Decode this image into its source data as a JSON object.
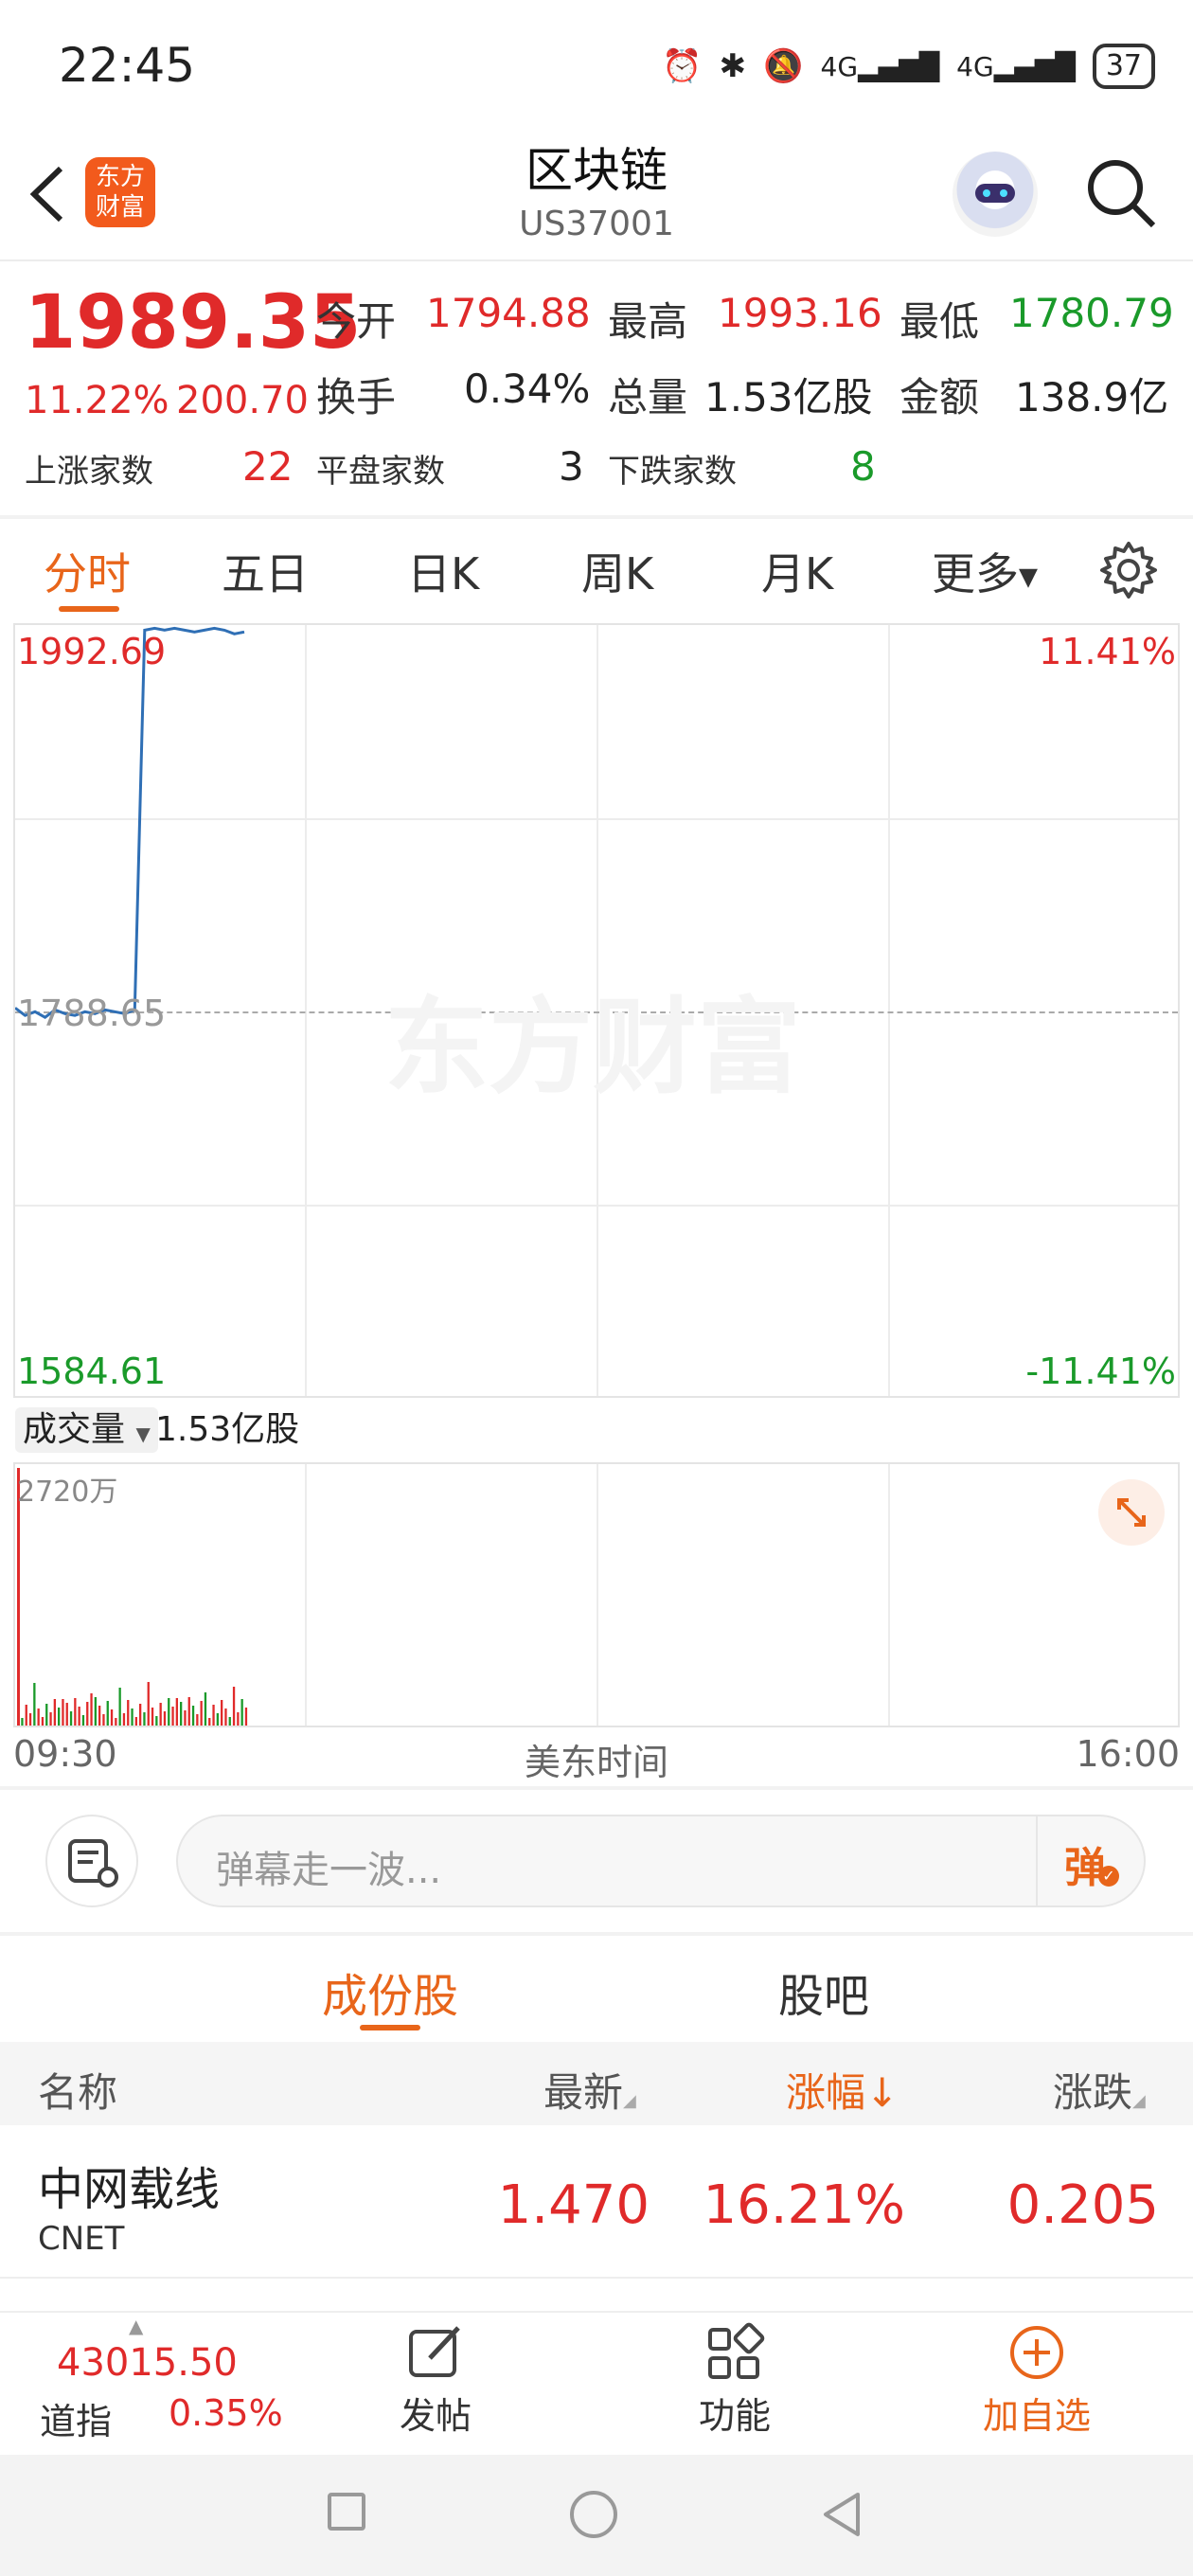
{
  "status_bar": {
    "time": "22:45",
    "battery": "37"
  },
  "header": {
    "title": "区块链",
    "code": "US37001",
    "logo_text": "东方财富"
  },
  "quote": {
    "price": "1989.35",
    "change_pct": "11.22%",
    "change_amt": "200.70",
    "stats": [
      {
        "label": "今开",
        "value": "1794.88",
        "color": "red"
      },
      {
        "label": "最高",
        "value": "1993.16",
        "color": "red"
      },
      {
        "label": "最低",
        "value": "1780.79",
        "color": "green"
      },
      {
        "label": "换手",
        "value": "0.34%",
        "color": "dark"
      },
      {
        "label": "总量",
        "value": "1.53亿股",
        "color": "dark"
      },
      {
        "label": "金额",
        "value": "138.9亿",
        "color": "dark"
      }
    ],
    "counts": [
      {
        "label": "上涨家数",
        "value": "22",
        "color": "red"
      },
      {
        "label": "平盘家数",
        "value": "3",
        "color": "dark"
      },
      {
        "label": "下跌家数",
        "value": "8",
        "color": "green"
      }
    ]
  },
  "tabs": [
    "分时",
    "五日",
    "日K",
    "周K",
    "月K",
    "更多"
  ],
  "active_tab": "分时",
  "chart": {
    "price_high": "1992.69",
    "price_mid": "1788.65",
    "price_low": "1584.61",
    "pct_high": "11.41%",
    "pct_low": "-11.41%",
    "watermark": "东方财富",
    "volume_selector": "成交量",
    "volume_total": "1.53亿股",
    "volume_max": "2720万",
    "time_start": "09:30",
    "time_label": "美东时间",
    "time_end": "16:00",
    "line_color": "#2f6fb5",
    "up_color": "#e02a2a",
    "down_color": "#1a9a2a"
  },
  "chart_data": {
    "type": "line",
    "x_start": "09:30",
    "x_end": "16:00",
    "ylim": [
      1584.61,
      1992.69
    ],
    "prev_close": 1788.65,
    "price_points": [
      1790,
      1786,
      1788,
      1785,
      1789,
      1787,
      1786,
      1788,
      1787,
      1789,
      1788,
      1787,
      1789,
      1992,
      1993,
      1992,
      1993,
      1992,
      1991,
      1992,
      1993,
      1992,
      1990,
      1991
    ],
    "volume_max": 27200000
  },
  "danmaku": {
    "placeholder": "弹幕走一波...",
    "send_label": "弹"
  },
  "section_tabs": [
    "成份股",
    "股吧"
  ],
  "table": {
    "headers": {
      "name": "名称",
      "latest": "最新",
      "change_pct": "涨幅",
      "change": "涨跌"
    },
    "rows": [
      {
        "name": "中网载线",
        "code": "CNET",
        "latest": "1.470",
        "change_pct": "16.21%",
        "change": "0.205"
      }
    ]
  },
  "bottom_bar": {
    "index_value": "43015.50",
    "index_name": "道指",
    "index_pct": "0.35%",
    "post": "发帖",
    "functions": "功能",
    "add_watch": "加自选"
  }
}
